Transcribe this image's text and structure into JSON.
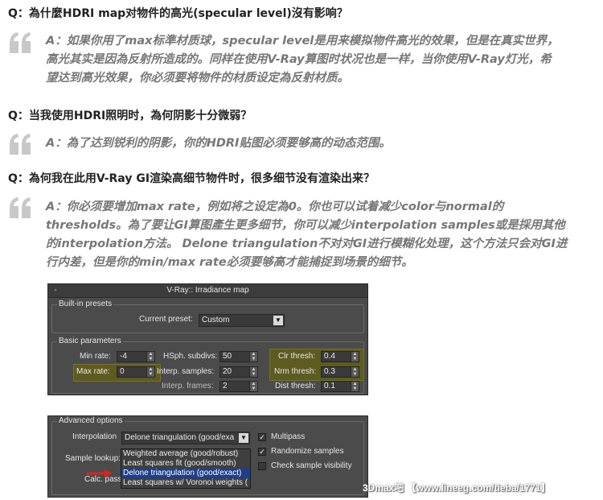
{
  "faq": [
    {
      "question": "Q：為什麼HDRI map对物件的高光(specular level)沒有影响？",
      "answer_lines": [
        "A：如果你用了max标準材质球，specular level是用来模拟物件高光的效果，但是在真实世界，",
        "高光其实是因為反射所造成的。同样在使用V-Ray算图时状况也是一样，当你使用V-Ray灯光，希",
        "望达到高光效果，你必须要将物件的材质设定為反射材质。"
      ]
    },
    {
      "question": "Q：当我使用HDRI照明时，為何阴影十分微弱？",
      "answer_lines": [
        "A：為了达到锐利的阴影，你的HDRI贴图必须要够高的动态范围。"
      ]
    },
    {
      "question": "Q：為何我在此用V-Ray GI渲染高细节物件时，很多细节没有渲染出来？",
      "answer_lines": [
        "A：你必须要增加max rate，例如将之设定為0。你也可以试着减少color与normal的",
        "thresholds。為了要让GI算图產生更多细节，你可以减少interpolation samples或是採用其他",
        "的interpolation方法。 Delone triangulation不对对GI进行模糊化处理，这个方法只会对GI进",
        "行内差，但是你的min/max rate必须要够高才能捕捉到场景的细节。"
      ]
    }
  ],
  "irradiance_panel": {
    "collapse": "-",
    "title": "V-Ray:: Irradiance map",
    "builtin_presets": "Built-in presets",
    "current_preset_label": "Current preset:",
    "current_preset_value": "Custom",
    "basic_parameters": "Basic parameters",
    "min_rate_label": "Min rate:",
    "min_rate": "-4",
    "max_rate_label": "Max rate:",
    "max_rate": "0",
    "hsph_label": "HSph. subdivs:",
    "hsph": "50",
    "interp_samples_label": "Interp. samples:",
    "interp_samples": "20",
    "interp_frames_label": "Interp. frames:",
    "interp_frames": "2",
    "clr_thresh_label": "Clr thresh:",
    "clr_thresh": "0.4",
    "nrm_thresh_label": "Nrm thresh:",
    "nrm_thresh": "0.3",
    "dist_thresh_label": "Dist thresh:",
    "dist_thresh": "0.1",
    "highlight_color": "#5e5b20"
  },
  "advanced_panel": {
    "title": "Advanced options",
    "interpolation_label": "Interpolation",
    "interpolation_value": "Delone triangulation (good/exa",
    "sample_lookup_label": "Sample lookup:",
    "calc_pass_label": "Calc. pass",
    "options": [
      "Weighted average (good/robust)",
      "Least squares fit (good/smooth)",
      "Delone triangulation (good/exact)",
      "Least squares w/ Voronoi weights ("
    ],
    "selected_index": 2,
    "multipass_label": "Multipass",
    "multipass": true,
    "randomize_label": "Randomize samples",
    "randomize": true,
    "check_visibility_label": "Check sample visibility",
    "check_visibility": false,
    "arrow_color": "#e02020"
  },
  "watermark": "3Dmax吧 【www.lineeg.com/tieba/1771】"
}
